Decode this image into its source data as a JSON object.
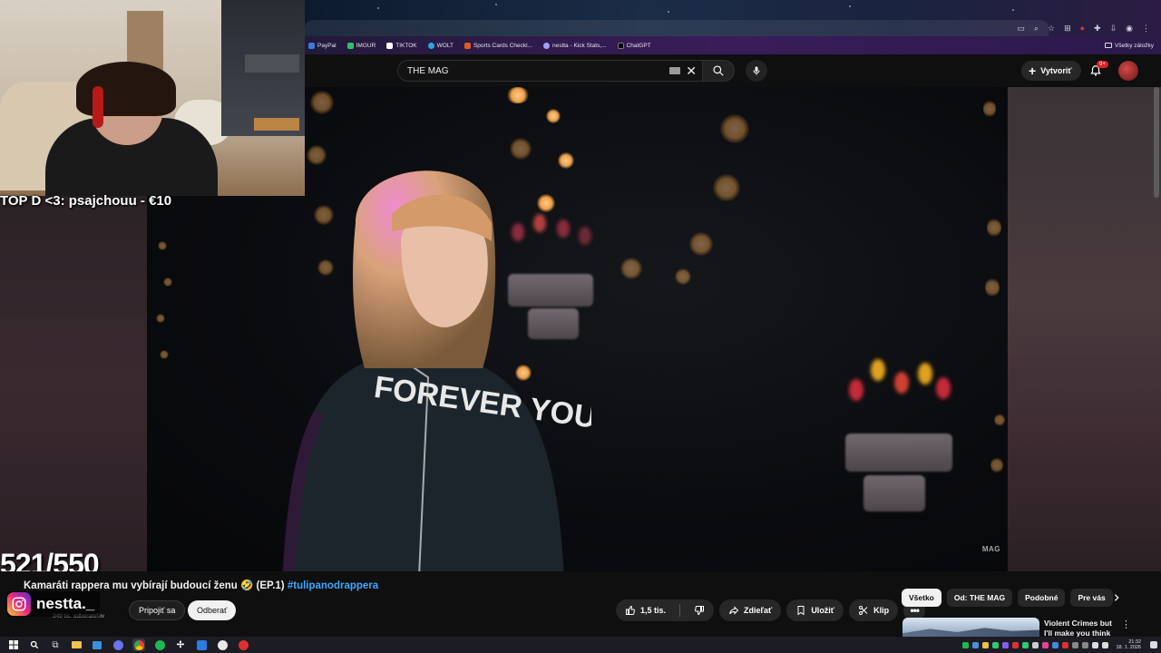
{
  "bookmarks": [
    {
      "label": "PayPal",
      "color": "#3b7bdf"
    },
    {
      "label": "IMGUR",
      "color": "#2fc26a"
    },
    {
      "label": "TIKTOK",
      "color": "#ffffff"
    },
    {
      "label": "WOLT",
      "color": "#2aa7e0"
    },
    {
      "label": "Sports Cards Checkl...",
      "color": "#e05a2a"
    },
    {
      "label": "nestta - Kick Stats,...",
      "color": "#a0a0ff"
    },
    {
      "label": "ChatGPT",
      "color": "#000000"
    }
  ],
  "all_bookmarks_label": "Všetky záložky",
  "search": {
    "value": "THE MAG"
  },
  "header": {
    "create_label": "Vytvoriť",
    "notif_badge": "9+"
  },
  "stream_overlay": {
    "donation_text": "TOP D <3: psajchouu - €10",
    "counter": "521/550",
    "instagram_handle": "nestta._"
  },
  "video": {
    "watermark": "MAG",
    "title": "Kamaráti rappera mu vybírají budoucí ženu 🤣 (EP.1)",
    "hashtag": "#tulipanodrappera",
    "hoodie_text": "FOREVER YOU"
  },
  "channel": {
    "subscribers": "349 tis. odberateľov",
    "join_label": "Pripojiť sa",
    "subscribe_label": "Odberať"
  },
  "actions": {
    "likes": "1,5 tis.",
    "share": "Zdieľať",
    "save": "Uložiť",
    "clip": "Klip"
  },
  "chips": [
    "Všetko",
    "Od: THE MAG",
    "Podobné",
    "Pre vás"
  ],
  "recommendation": {
    "title": "Violent Crimes but I'll make you think"
  },
  "taskbar": {
    "time": "21:32",
    "date": "18. 1. 2026"
  },
  "colors": {
    "accent_link": "#3ea6ff",
    "youtube_bg": "#0f0f0f",
    "notification_red": "#e02020"
  }
}
